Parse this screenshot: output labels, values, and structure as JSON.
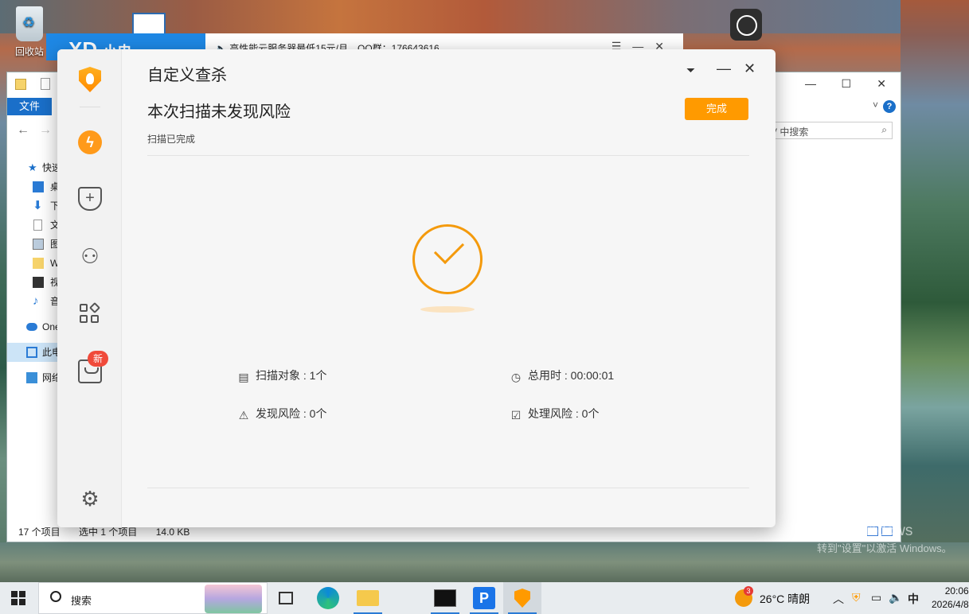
{
  "desktop": {
    "recycle_bin_label": "回收站"
  },
  "bg_window": {
    "logo": "XD",
    "logo_suffix": "小电",
    "notice": "高性能云服务器最低15元/月，QQ群：176643616"
  },
  "explorer": {
    "file_tab": "文件",
    "search_placeholder": "在 ... 中搜索",
    "search_visible": "V 中搜索",
    "tree": [
      {
        "label": "快速访问",
        "icon": "star-icon"
      },
      {
        "label": "桌面",
        "icon": "desktop-icon"
      },
      {
        "label": "下载",
        "icon": "download-icon"
      },
      {
        "label": "文档",
        "icon": "document-icon"
      },
      {
        "label": "图片",
        "icon": "picture-icon"
      },
      {
        "label": "WPS",
        "icon": "folder-icon"
      },
      {
        "label": "视频",
        "icon": "video-icon"
      },
      {
        "label": "音乐",
        "icon": "music-icon"
      },
      {
        "label": "OneDrive",
        "icon": "cloud-icon"
      },
      {
        "label": "此电脑",
        "icon": "computer-icon"
      },
      {
        "label": "网络",
        "icon": "network-icon"
      }
    ],
    "status_items": "17 个项目",
    "status_selected": "选中 1 个项目",
    "status_size": "14.0 KB"
  },
  "av": {
    "title": "自定义查杀",
    "headline": "本次扫描未发现风险",
    "subtitle": "扫描已完成",
    "done_button": "完成",
    "new_badge": "新",
    "accent": "#ff9a00",
    "stats": {
      "scan_objects": "扫描对象 : 1个",
      "total_time": "总用时 : 00:00:01",
      "risks_found": "发现风险 : 0个",
      "risks_handled": "处理风险 : 0个"
    }
  },
  "watermark": {
    "line1": "激活 Windows",
    "line2": "转到\"设置\"以激活 Windows。"
  },
  "taskbar": {
    "search_label": "搜索",
    "weather_badge": "3",
    "weather_text": "26°C  晴朗",
    "ime": "中",
    "time": "20:06",
    "date": "2026/4/8"
  }
}
